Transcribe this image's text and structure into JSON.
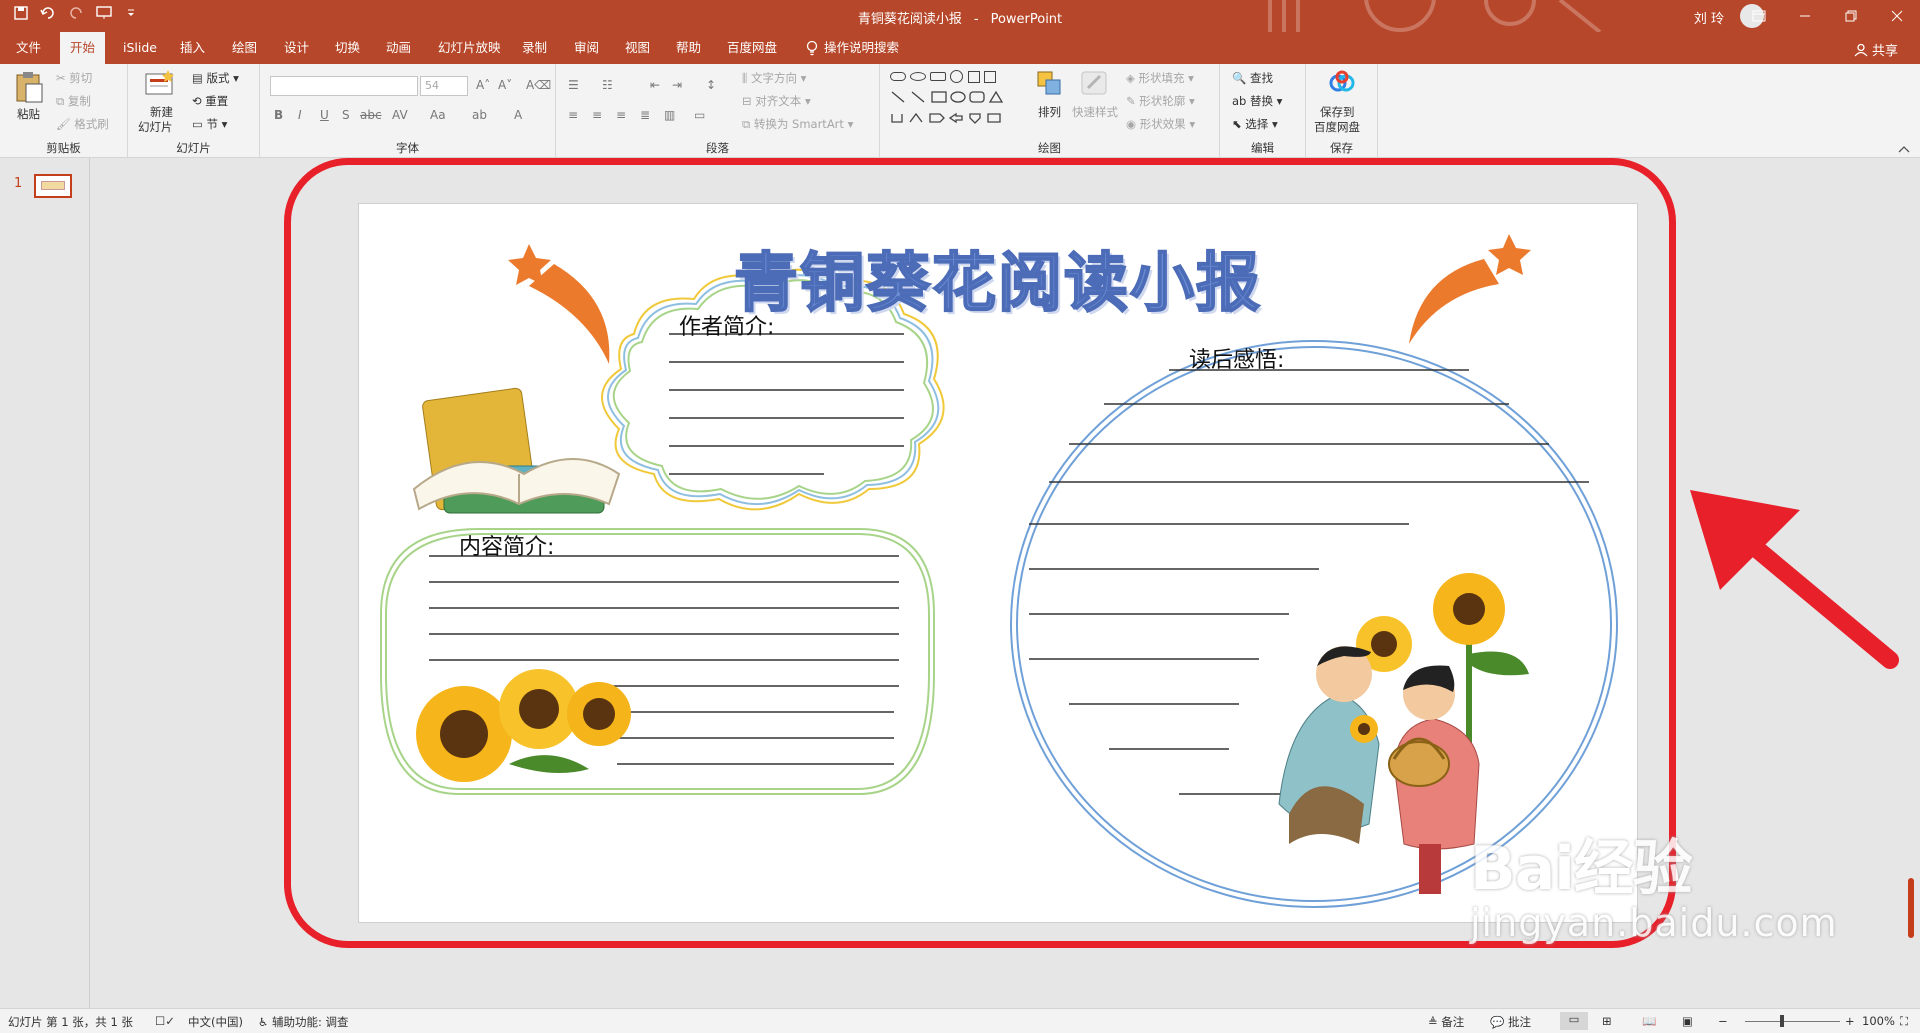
{
  "titlebar": {
    "doc_title": "青铜葵花阅读小报",
    "app_name": "PowerPoint",
    "user_name": "刘 玲"
  },
  "tabs": [
    "文件",
    "开始",
    "iSlide",
    "插入",
    "绘图",
    "设计",
    "切换",
    "动画",
    "幻灯片放映",
    "录制",
    "审阅",
    "视图",
    "帮助",
    "百度网盘"
  ],
  "tell_me": "操作说明搜索",
  "share_label": "共享",
  "ribbon": {
    "clipboard": {
      "paste": "粘贴",
      "cut": "剪切",
      "copy": "复制",
      "format_painter": "格式刷",
      "label": "剪贴板"
    },
    "slides": {
      "new_slide_1": "新建",
      "new_slide_2": "幻灯片",
      "layout": "版式",
      "reset": "重置",
      "section": "节",
      "label": "幻灯片"
    },
    "font": {
      "size": "54",
      "label": "字体"
    },
    "paragraph": {
      "text_direction": "文字方向",
      "align_text": "对齐文本",
      "smartart": "转换为 SmartArt",
      "label": "段落"
    },
    "drawing": {
      "arrange": "排列",
      "quick_styles": "快速样式",
      "shape_fill": "形状填充",
      "shape_outline": "形状轮廓",
      "shape_effects": "形状效果",
      "label": "绘图"
    },
    "editing": {
      "find": "查找",
      "replace": "替换",
      "select": "选择",
      "label": "编辑"
    },
    "save": {
      "save_1": "保存到",
      "save_2": "百度网盘",
      "label": "保存"
    }
  },
  "thumbnail_number": "1",
  "slide": {
    "title": "青铜葵花阅读小报",
    "author_label": "作者简介:",
    "content_label": "内容简介:",
    "reflection_label": "读后感悟:"
  },
  "statusbar": {
    "slide_info": "幻灯片 第 1 张，共 1 张",
    "language": "中文(中国)",
    "accessibility": "辅助功能: 调查",
    "notes": "备注",
    "comments": "批注",
    "zoom": "100%"
  },
  "watermark": {
    "line1": "Bai经验",
    "line2": "jingyan.baidu.com"
  },
  "colors": {
    "accent": "#b7472a",
    "highlight": "#e8202a",
    "title_blue": "#6d8fd6",
    "star_orange": "#ec7a2c"
  }
}
